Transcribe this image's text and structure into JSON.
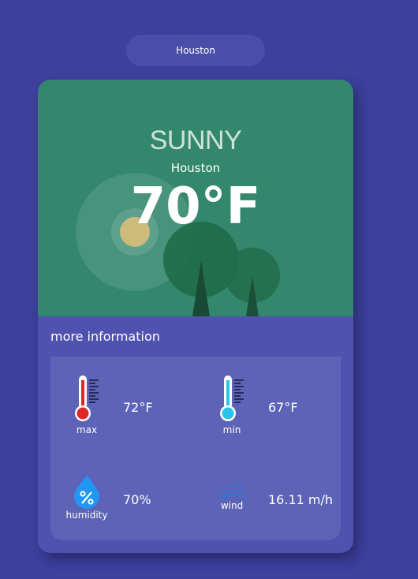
{
  "search": {
    "city": "Houston"
  },
  "weather": {
    "condition": "SUNNY",
    "city": "Houston",
    "temperature": "70°F"
  },
  "info": {
    "title": "more information",
    "max": {
      "label": "max",
      "value": "72°F",
      "icon": "thermometer-hot-icon"
    },
    "min": {
      "label": "min",
      "value": "67°F",
      "icon": "thermometer-cold-icon"
    },
    "humidity": {
      "label": "humidity",
      "value": "70%",
      "icon": "humidity-drop-icon"
    },
    "wind": {
      "label": "wind",
      "value": "16.11 m/h",
      "icon": "wind-icon"
    }
  },
  "colors": {
    "background": "#3d409c",
    "hero": "#33876c",
    "card": "#4f52ae",
    "panel": "#5d63b6",
    "hot": "#e0262a",
    "cold": "#29c3ee",
    "drop": "#2196f3"
  }
}
